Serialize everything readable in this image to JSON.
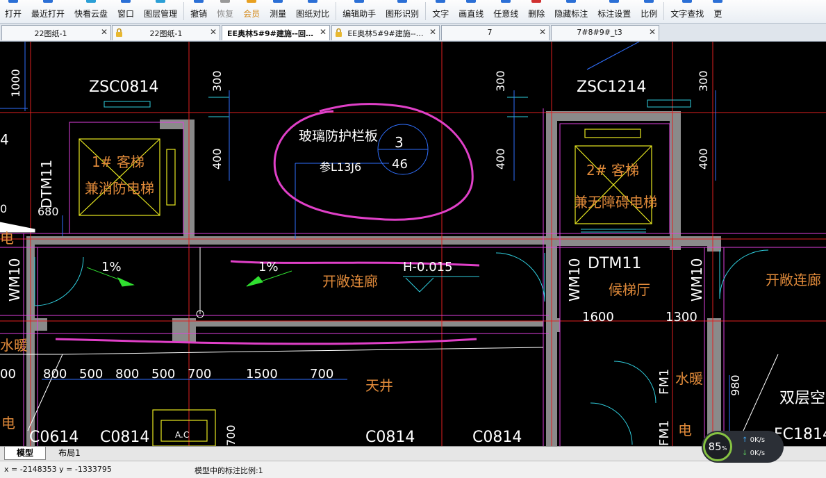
{
  "toolbar": {
    "items": [
      {
        "label": "打开",
        "state": "normal",
        "icon": "folder-open-icon"
      },
      {
        "label": "最近打开",
        "state": "normal",
        "icon": "recent-icon"
      },
      {
        "label": "快看云盘",
        "state": "normal",
        "icon": "cloud-icon"
      },
      {
        "label": "窗口",
        "state": "normal",
        "icon": "window-icon"
      },
      {
        "label": "图层管理",
        "state": "normal",
        "icon": "layers-icon"
      },
      {
        "label": "撤销",
        "state": "normal",
        "icon": "undo-icon"
      },
      {
        "label": "恢复",
        "state": "disabled",
        "icon": "redo-icon"
      },
      {
        "label": "会员",
        "state": "member",
        "icon": "crown-icon"
      },
      {
        "label": "测量",
        "state": "normal",
        "icon": "ruler-icon"
      },
      {
        "label": "图纸对比",
        "state": "normal",
        "icon": "compare-icon"
      },
      {
        "label": "编辑助手",
        "state": "normal",
        "icon": "edit-icon"
      },
      {
        "label": "图形识别",
        "state": "normal",
        "icon": "recognize-icon"
      },
      {
        "label": "文字",
        "state": "normal",
        "icon": "text-icon"
      },
      {
        "label": "画直线",
        "state": "normal",
        "icon": "line-icon"
      },
      {
        "label": "任意线",
        "state": "normal",
        "icon": "freeline-icon"
      },
      {
        "label": "删除",
        "state": "normal",
        "icon": "delete-icon"
      },
      {
        "label": "隐藏标注",
        "state": "normal",
        "icon": "hide-icon"
      },
      {
        "label": "标注设置",
        "state": "normal",
        "icon": "settings-icon"
      },
      {
        "label": "比例",
        "state": "normal",
        "icon": "scale-icon"
      },
      {
        "label": "文字查找",
        "state": "normal",
        "icon": "search-icon"
      },
      {
        "label": "更",
        "state": "normal",
        "icon": "more-icon"
      }
    ]
  },
  "tabs": [
    {
      "label": "22图纸-1",
      "locked": false,
      "active": false
    },
    {
      "label": "22图纸-1",
      "locked": true,
      "active": false
    },
    {
      "label": "EE奥林5#9#建施--回…",
      "locked": false,
      "active": true
    },
    {
      "label": "EE奥林5#9#建施--…",
      "locked": true,
      "active": false
    },
    {
      "label": "7",
      "locked": false,
      "active": false
    },
    {
      "label": "7#8#9#_t3",
      "locked": false,
      "active": false
    }
  ],
  "drawing": {
    "texts": {
      "zsc_left": "ZSC0814",
      "zsc_right": "ZSC1214",
      "dim_1000": "1000",
      "dim_300_a": "300",
      "dim_300_b": "300",
      "dim_300_c": "300",
      "dim_400_a": "400",
      "dim_400_b": "400",
      "dim_400_c": "400",
      "dim_4": "4",
      "elevator1_a": "1# 客梯",
      "elevator1_b": "兼消防电梯",
      "elevator2_a": "2# 客梯",
      "elevator2_b": "兼无障碍电梯",
      "dtm_left": "DTM11",
      "dtm_right": "DTM11",
      "dim_680": "680",
      "dim_0": "0",
      "dian_left": "电",
      "glass": "玻璃防护栏板",
      "ref": "参L13J6",
      "circle_top": "3",
      "circle_bottom": "46",
      "slope_a": "1%",
      "slope_b": "1%",
      "elev": "H-0.015",
      "open_corridor_a": "开敞连廊",
      "open_corridor_b": "开敞连廊",
      "wm_a": "WM10",
      "wm_b": "WM10",
      "wm_c": "WM10",
      "lobby": "候梯厅",
      "dim_1600": "1600",
      "dim_1300": "1300",
      "shuinuan_left": "水暖",
      "shuinuan_right": "水暖",
      "dims_row": [
        "00",
        "800",
        "500",
        "800",
        "500",
        "700",
        "1500",
        "700"
      ],
      "tianjing": "天井",
      "fm_a": "FM1",
      "fm_b": "FM1",
      "dian_right": "电",
      "dim_980": "980",
      "double_space": "双层空",
      "fc": "FC1814",
      "c_a": "C0614",
      "c_b": "C0814",
      "c_c": "C0814",
      "c_d": "C0814",
      "ac": "A.C",
      "dim_700v": "700",
      "dian_bl": "电"
    }
  },
  "layout_tabs": [
    {
      "label": "模型",
      "active": true
    },
    {
      "label": "布局1",
      "active": false
    }
  ],
  "status": {
    "coords": "x = -2148353  y = -1333795",
    "scale": "模型中的标注比例:1"
  },
  "network": {
    "percent": "85",
    "percent_unit": "%",
    "up": "0",
    "up_unit": "K/s",
    "down": "0",
    "down_unit": "K/s"
  }
}
